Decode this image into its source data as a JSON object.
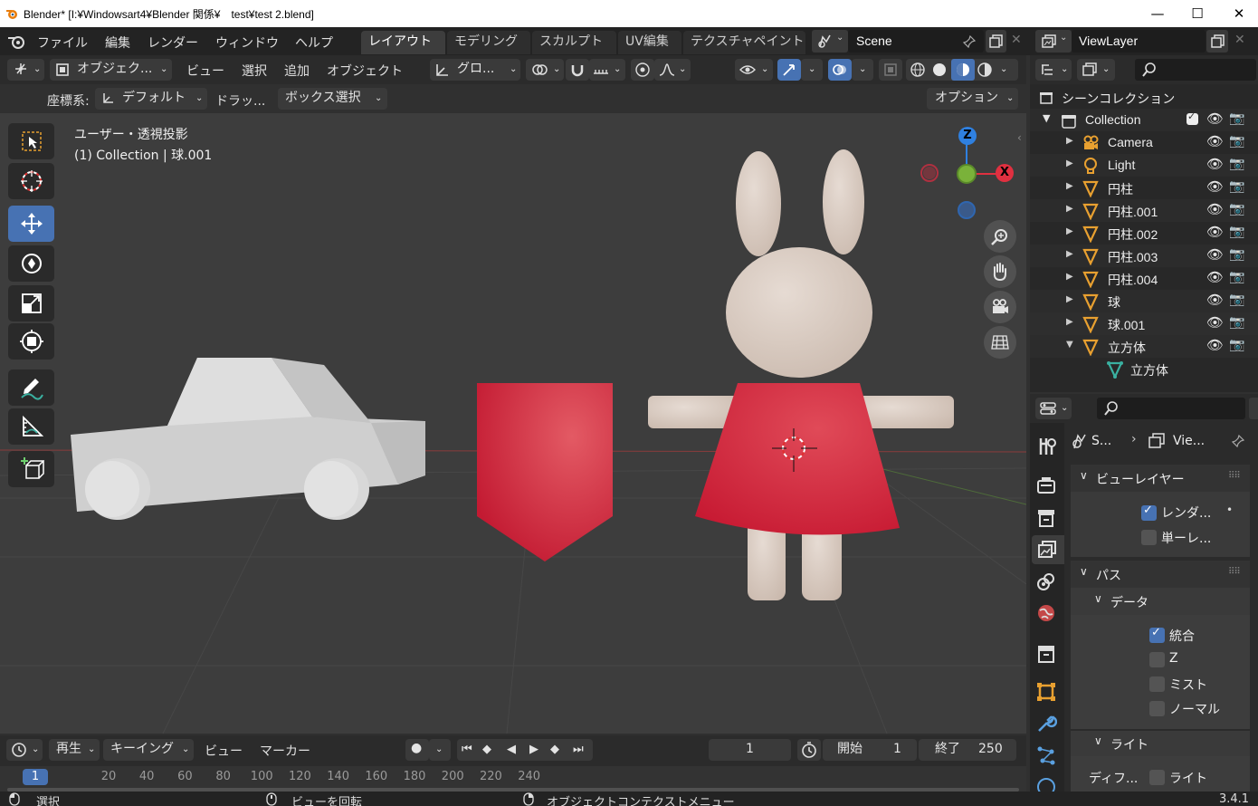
{
  "window": {
    "title": "Blender* [I:¥Windowsart4¥Blender 関係¥　test¥test 2.blend]",
    "minimize": "—",
    "maximize": "☐",
    "close": "✕"
  },
  "menu": [
    "ファイル",
    "編集",
    "レンダー",
    "ウィンドウ",
    "ヘルプ"
  ],
  "workspaces": [
    "レイアウト",
    "モデリング",
    "スカルプト",
    "UV編集",
    "テクスチャペイント"
  ],
  "scene": {
    "name": "Scene"
  },
  "viewlayer": {
    "name": "ViewLayer"
  },
  "viewport_header": {
    "mode": "オブジェク...",
    "menus": [
      "ビュー",
      "選択",
      "追加",
      "オブジェクト"
    ],
    "transform_orientation": "グロ...",
    "coord_label": "座標系:",
    "coord_value": "デフォルト",
    "drag_label": "ドラッ...",
    "box_select": "ボックス選択",
    "options": "オプション"
  },
  "viewport": {
    "view_name": "ユーザー・透視投影",
    "object_info": "(1) Collection | 球.001",
    "gizmo": {
      "z": "Z",
      "x": "X"
    }
  },
  "outliner": {
    "root": "シーンコレクション",
    "collection": "Collection",
    "items": [
      {
        "label": "Camera",
        "icon": "camera-icon"
      },
      {
        "label": "Light",
        "icon": "light-icon"
      },
      {
        "label": "円柱",
        "icon": "mesh-icon"
      },
      {
        "label": "円柱.001",
        "icon": "mesh-icon"
      },
      {
        "label": "円柱.002",
        "icon": "mesh-icon"
      },
      {
        "label": "円柱.003",
        "icon": "mesh-icon"
      },
      {
        "label": "円柱.004",
        "icon": "mesh-icon"
      },
      {
        "label": "球",
        "icon": "mesh-icon"
      },
      {
        "label": "球.001",
        "icon": "mesh-icon"
      },
      {
        "label": "立方体",
        "icon": "mesh-icon"
      }
    ],
    "child": "立方体"
  },
  "properties": {
    "breadcrumb_scene": "S...",
    "breadcrumb_view": "Vie...",
    "view_layer_title": "ビューレイヤー",
    "render_check": "レンダ...",
    "single_check": "単ーレ...",
    "passes_title": "パス",
    "data_title": "データ",
    "combined": "統合",
    "z": "Z",
    "mist": "ミスト",
    "normal": "ノーマル",
    "light_title": "ライト",
    "diffuse": "ディフ...",
    "light_check": "ライト"
  },
  "timeline": {
    "playback": "再生",
    "keying": "キーイング",
    "view": "ビュー",
    "marker": "マーカー",
    "current_frame": "1",
    "start_label": "開始",
    "start_value": "1",
    "end_label": "終了",
    "end_value": "250",
    "ruler_current": "1",
    "ruler": [
      "20",
      "40",
      "60",
      "80",
      "100",
      "120",
      "140",
      "160",
      "180",
      "200",
      "220",
      "240"
    ]
  },
  "status": {
    "select": "選択",
    "rotate": "ビューを回転",
    "context": "オブジェクトコンテクストメニュー",
    "version": "3.4.1"
  }
}
